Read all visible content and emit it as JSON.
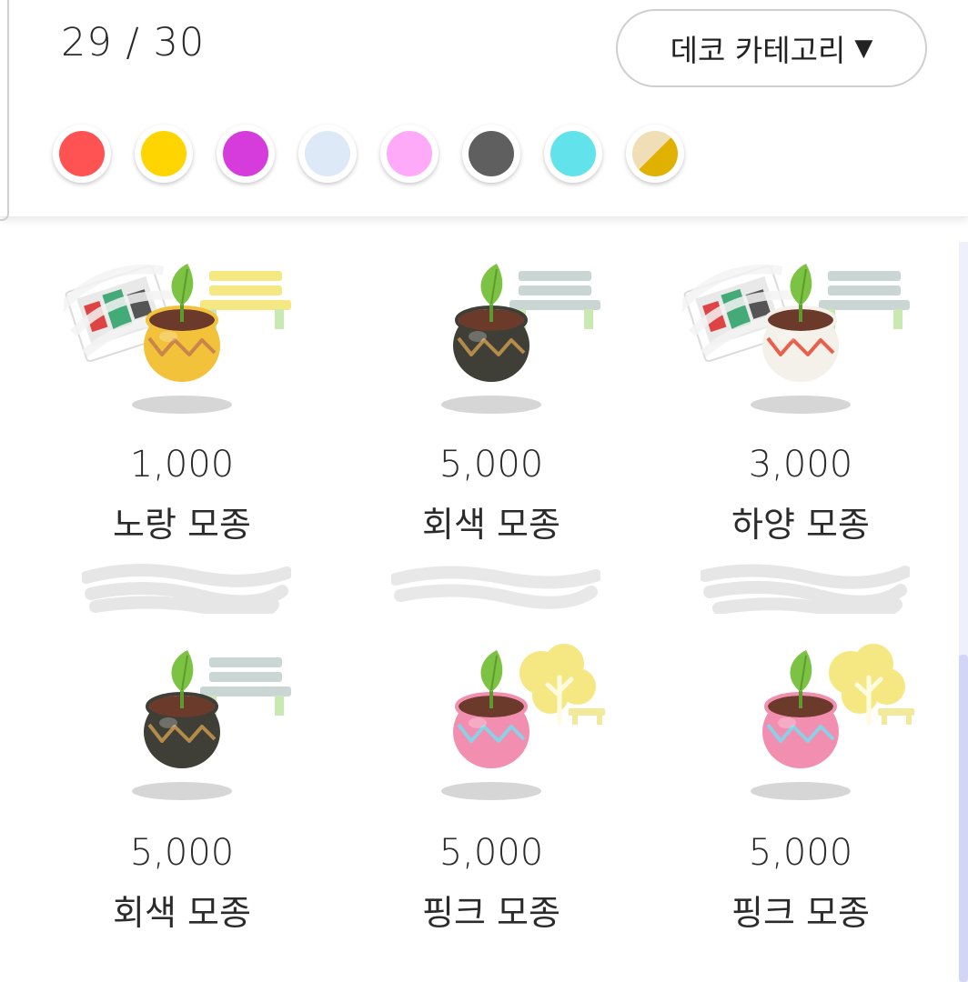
{
  "header": {
    "counter": "29 / 30",
    "category_label": "데코 카테고리",
    "caret": "▼"
  },
  "color_filters": [
    {
      "name": "red",
      "color": "#ff5252"
    },
    {
      "name": "yellow",
      "color": "#ffd500"
    },
    {
      "name": "magenta",
      "color": "#d63cdc"
    },
    {
      "name": "light-blue",
      "color": "#dde9f7"
    },
    {
      "name": "pink",
      "color": "#ffaaf8"
    },
    {
      "name": "gray",
      "color": "#5f5f5f"
    },
    {
      "name": "cyan",
      "color": "#62e2ea"
    },
    {
      "name": "gold-beige",
      "color": "#e0b100",
      "color2": "#f0dfb6"
    }
  ],
  "items": [
    {
      "price": "1,000",
      "name": "노랑 모종",
      "pot_color": "#f2c23a",
      "pot_pattern": "#c9854a",
      "deco": "bench",
      "deco_color": "#f5e882",
      "owned": true
    },
    {
      "price": "5,000",
      "name": "회색 모종",
      "pot_color": "#3f3f38",
      "pot_pattern": "#b48b4a",
      "deco": "bench",
      "deco_color": "#c9d6d3",
      "owned": false
    },
    {
      "price": "3,000",
      "name": "하양 모종",
      "pot_color": "#f4f0ea",
      "pot_pattern": "#e8604c",
      "deco": "bench",
      "deco_color": "#c9d6d3",
      "owned": true
    },
    {
      "price": "5,000",
      "name": "회색 모종",
      "pot_color": "#3f3f38",
      "pot_pattern": "#b48b4a",
      "deco": "bench",
      "deco_color": "#c9d6d3",
      "owned": false
    },
    {
      "price": "5,000",
      "name": "핑크 모종",
      "pot_color": "#f28fb0",
      "pot_pattern": "#8ad0e6",
      "deco": "tree",
      "deco_color": "#f5e882",
      "owned": false
    },
    {
      "price": "5,000",
      "name": "핑크 모종",
      "pot_color": "#f28fb0",
      "pot_pattern": "#8ad0e6",
      "deco": "tree",
      "deco_color": "#f5e882",
      "owned": false
    }
  ]
}
